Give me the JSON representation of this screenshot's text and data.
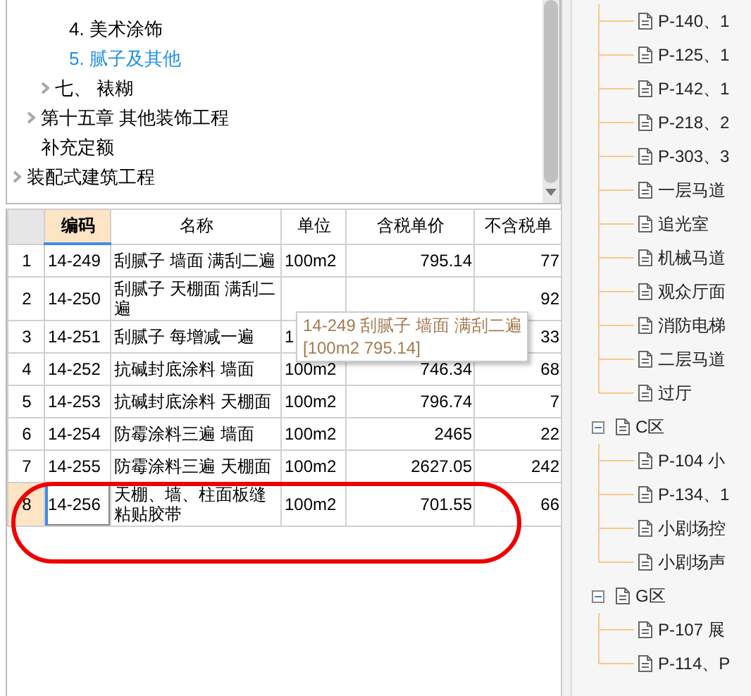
{
  "top_tree": [
    {
      "children": [
        {
          "children": [
            {
              "children": [
                {
                  "label": "4. 美术涂饰",
                  "selected": false
                },
                {
                  "label": "5. 腻子及其他",
                  "selected": true
                }
              ]
            },
            {
              "label": "七、 裱糊",
              "expandable": true,
              "selected": false
            }
          ]
        },
        {
          "label": "第十五章 其他装饰工程",
          "expandable": true,
          "selected": false
        },
        {
          "label": "补充定额",
          "expandable": false,
          "selected": false
        }
      ]
    },
    {
      "label": "装配式建筑工程",
      "expandable": true,
      "selected": false
    }
  ],
  "table": {
    "columns": [
      {
        "label": "编码",
        "selected": true
      },
      {
        "label": "名称",
        "selected": false
      },
      {
        "label": "单位",
        "selected": false
      },
      {
        "label": "含税单价",
        "selected": false
      },
      {
        "label": "不含税单",
        "selected": false
      }
    ],
    "rows": [
      {
        "num": "1",
        "code": "14-249",
        "name": "刮腻子 墙面 满刮二遍",
        "unit": "100m2",
        "price": "795.14",
        "price_ex": "77",
        "selected": false
      },
      {
        "num": "2",
        "code": "14-250",
        "name": "刮腻子 天棚面 满刮二遍",
        "price_ex": "92",
        "selected": false
      },
      {
        "num": "3",
        "code": "14-251",
        "name": "刮腻子 每增减一遍",
        "unit": "1",
        "price_ex": "33",
        "selected": false
      },
      {
        "num": "4",
        "code": "14-252",
        "name": "抗碱封底涂料 墙面",
        "unit": "100m2",
        "price": "746.34",
        "price_ex": "68",
        "selected": false
      },
      {
        "num": "5",
        "code": "14-253",
        "name": "抗碱封底涂料 天棚面",
        "unit": "100m2",
        "price": "796.74",
        "price_ex": "7",
        "selected": false
      },
      {
        "num": "6",
        "code": "14-254",
        "name": "防霉涂料三遍 墙面",
        "unit": "100m2",
        "price": "2465",
        "price_ex": "22",
        "selected": false
      },
      {
        "num": "7",
        "code": "14-255",
        "name": "防霉涂料三遍 天棚面",
        "unit": "100m2",
        "price": "2627.05",
        "price_ex": "242",
        "selected": false
      },
      {
        "num": "8",
        "code": "14-256",
        "name": "天棚、墙、柱面板缝粘贴胶带",
        "unit": "100m2",
        "price": "701.55",
        "price_ex": "66",
        "selected": true
      }
    ]
  },
  "tooltip": {
    "line_1": "14-249 刮腻子 墙面 满刮二遍",
    "line_2": "[100m2 795.14]"
  },
  "right_tree": [
    {
      "children": [
        {
          "label": "P-140、1"
        },
        {
          "label": "P-125、1"
        },
        {
          "label": "P-142、1"
        },
        {
          "label": "P-218、2"
        },
        {
          "label": "P-303、3"
        },
        {
          "label": "一层马道"
        },
        {
          "label": "追光室"
        },
        {
          "label": "机械马道"
        },
        {
          "label": "观众厅面"
        },
        {
          "label": "消防电梯"
        },
        {
          "label": "二层马道"
        },
        {
          "label": "过厅"
        }
      ]
    },
    {
      "label": "C区",
      "expanded": true,
      "children": [
        {
          "label": "P-104 小"
        },
        {
          "label": "P-134、1"
        },
        {
          "label": "小剧场控"
        },
        {
          "label": "小剧场声"
        }
      ]
    },
    {
      "label": "G区",
      "expanded": true,
      "children": [
        {
          "label": "P-107 展"
        },
        {
          "label": "P-114、P"
        }
      ]
    }
  ]
}
